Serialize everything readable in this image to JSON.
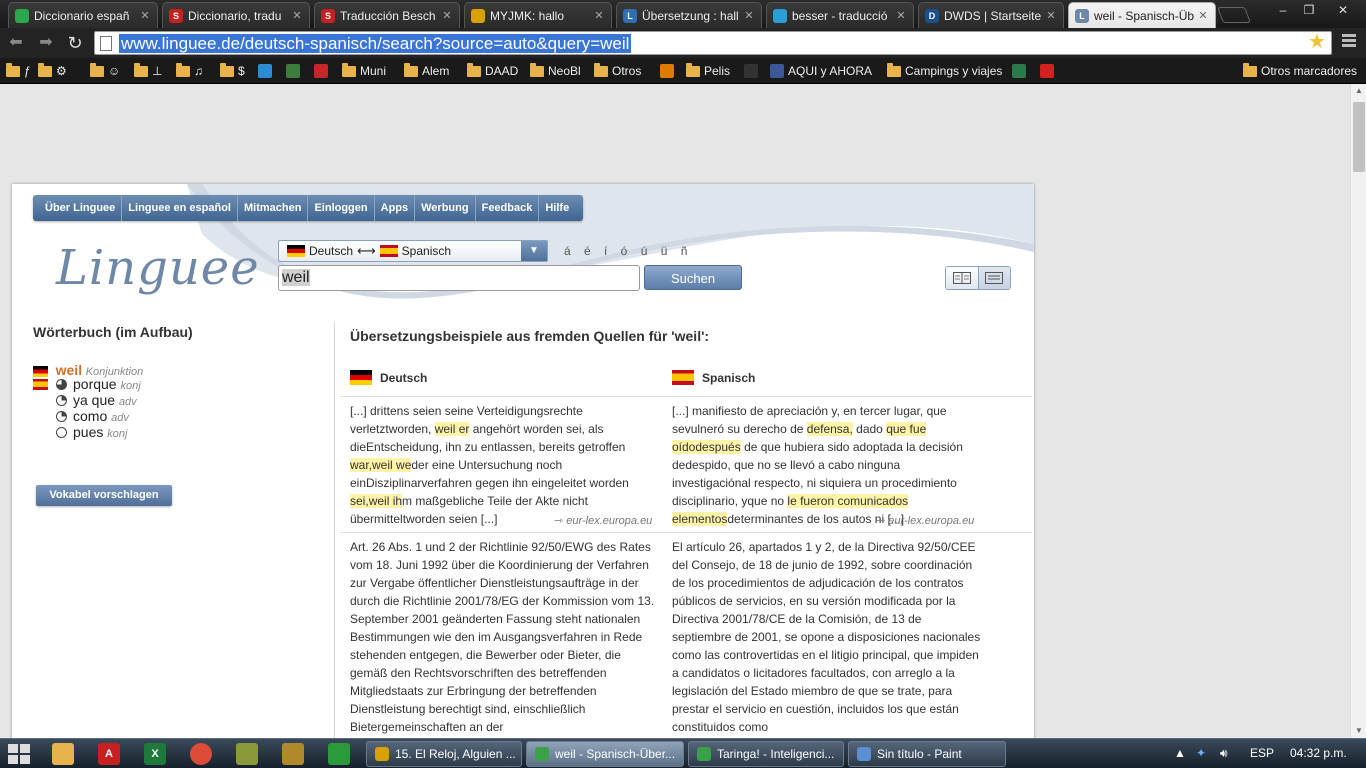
{
  "browser": {
    "tabs": [
      {
        "title": "Diccionario españ",
        "color": "#2aa84a",
        "glyph": ""
      },
      {
        "title": "Diccionario, tradu",
        "color": "#c62020",
        "glyph": "S"
      },
      {
        "title": "Traducción Besch",
        "color": "#c62020",
        "glyph": "S"
      },
      {
        "title": "MYJMK: hallo",
        "color": "#d9a100",
        "glyph": ""
      },
      {
        "title": "Übersetzung : hall",
        "color": "#2f6fb5",
        "glyph": "L"
      },
      {
        "title": "besser - traducció",
        "color": "#2a9fd6",
        "glyph": ""
      },
      {
        "title": "DWDS | Startseite",
        "color": "#1a4f8b",
        "glyph": "D"
      },
      {
        "title": "weil - Spanisch-Üb",
        "color": "#6f88a8",
        "glyph": "L"
      }
    ],
    "url": "www.linguee.de/deutsch-spanisch/search?source=auto&query=weil",
    "window_controls": [
      "–",
      "❐",
      "✕"
    ],
    "bookmarks": [
      {
        "label": "ƒ",
        "kind": "folder"
      },
      {
        "label": "⚙",
        "kind": "folder"
      },
      {
        "label": "☺",
        "kind": "folder"
      },
      {
        "label": "⊥",
        "kind": "folder"
      },
      {
        "label": "♫",
        "kind": "folder"
      },
      {
        "label": "$",
        "kind": "folder"
      },
      {
        "label": "",
        "kind": "site",
        "color": "#2a8bd6"
      },
      {
        "label": "",
        "kind": "site",
        "color": "#3b7d3b"
      },
      {
        "label": "",
        "kind": "site",
        "color": "#c62828"
      },
      {
        "label": "Muni",
        "kind": "folder"
      },
      {
        "label": "Alem",
        "kind": "folder"
      },
      {
        "label": "DAAD",
        "kind": "folder"
      },
      {
        "label": "NeoBl",
        "kind": "folder"
      },
      {
        "label": "Otros",
        "kind": "folder"
      },
      {
        "label": "",
        "kind": "site",
        "color": "#e07b00"
      },
      {
        "label": "Pelis",
        "kind": "folder"
      },
      {
        "label": "",
        "kind": "site",
        "color": "#333333"
      },
      {
        "label": "AQUI y AHORA",
        "kind": "site",
        "color": "#3b5998"
      },
      {
        "label": "Campings y viajes",
        "kind": "folder"
      },
      {
        "label": "",
        "kind": "site",
        "color": "#2a7a4a"
      },
      {
        "label": "",
        "kind": "site",
        "color": "#d32020"
      }
    ],
    "other_bookmarks": "Otros marcadores"
  },
  "page": {
    "nav": [
      "Über Linguee",
      "Linguee en español",
      "Mitmachen",
      "Einloggen",
      "Apps",
      "Werbung",
      "Feedback",
      "Hilfe"
    ],
    "logo": "Linguee",
    "lang_from": "Deutsch",
    "lang_to": "Spanisch",
    "special_chars": "á é í ó ú ü ñ",
    "search_value": "weil",
    "search_button": "Suchen",
    "dictionary": {
      "title": "Wörterbuch (im Aufbau)",
      "lemma": "weil",
      "lemma_pos": "Konjunktion",
      "translations": [
        {
          "word": "porque",
          "pos": "konj",
          "frequency": 0.75
        },
        {
          "word": "ya que",
          "pos": "adv",
          "frequency": 0.25
        },
        {
          "word": "como",
          "pos": "adv",
          "frequency": 0.25
        },
        {
          "word": "pues",
          "pos": "konj",
          "frequency": 0
        }
      ],
      "suggest_button": "Vokabel vorschlagen"
    },
    "examples": {
      "title": "Übersetzungsbeispiele aus fremden Quellen für 'weil':",
      "col_de": "Deutsch",
      "col_es": "Spanisch",
      "items": [
        {
          "de": [
            {
              "t": "[...] drittens seien seine Verteidigungsrechte verletzt"
            },
            {
              "t": "worden, "
            },
            {
              "t": "weil er",
              "hl": true
            },
            {
              "t": " angehört worden sei, als die"
            },
            {
              "t": "Entscheidung, ihn zu entlassen, bereits getroffen "
            },
            {
              "t": "war,",
              "hl": true
            },
            {
              "t": "weil we",
              "hl": true
            },
            {
              "t": "der eine Untersuchung noch ein"
            },
            {
              "t": "Disziplinarverfahren gegen ihn eingeleitet worden "
            },
            {
              "t": "sei,",
              "hl": true
            },
            {
              "t": "weil ih",
              "hl": true
            },
            {
              "t": "m maßgebliche Teile der Akte nicht übermittelt"
            },
            {
              "t": "worden seien [...]"
            }
          ],
          "es": [
            {
              "t": "[...] manifiesto de apreciación y, en tercer lugar, que se"
            },
            {
              "t": "vulneró su derecho de "
            },
            {
              "t": "defensa,",
              "hl": true
            },
            {
              "t": " dado "
            },
            {
              "t": "que fue oído",
              "hl": true
            },
            {
              "t": "después",
              "hl": true
            },
            {
              "t": " de que hubiera sido adoptada la decisión de"
            },
            {
              "t": "despido, que no se llevó a cabo ninguna investigación"
            },
            {
              "t": "al respecto, ni siquiera un procedimiento disciplinario, y"
            },
            {
              "t": "que no "
            },
            {
              "t": "le fueron comunicados elementos",
              "hl": true
            },
            {
              "t": "determinantes de los autos ni [...]"
            }
          ],
          "src_de": "eur-lex.europa.eu",
          "src_es": "eur-lex.europa.eu"
        },
        {
          "de_text": "Art. 26 Abs. 1 und 2 der Richtlinie 92/50/EWG des Rates vom 18. Juni 1992 über die Koordinierung der Verfahren zur Vergabe öffentlicher Dienstleistungsaufträge in der durch die Richtlinie 2001/78/EG der Kommission vom 13. September 2001 geänderten Fassung steht nationalen Bestimmungen wie den im Ausgangsverfahren in Rede stehenden entgegen, die Bewerber oder Bieter, die gemäß den Rechtsvorschriften des betreffenden Mitgliedstaats zur Erbringung der betreffenden Dienstleistung berechtigt sind, einschließlich Bietergemeinschaften an der",
          "es_text": "El artículo 26, apartados 1 y 2, de la Directiva 92/50/CEE del Consejo, de 18 de junio de 1992, sobre coordinación de los procedimientos de adjudicación de los contratos públicos de servicios, en su versión modificada por la Directiva 2001/78/CE de la Comisión, de 13 de septiembre de 2001, se opone a disposiciones nacionales como las controvertidas en el litigio principal, que impiden a candidatos o licitadores facultados, con arreglo a la legislación del Estado miembro de que se trate, para prestar el servicio en cuestión, incluidos los que están constituidos como"
        }
      ]
    }
  },
  "taskbar": {
    "tasks": [
      {
        "label": "15. El Reloj,  Alguien ...",
        "color": "#d9a100"
      },
      {
        "label": "weil - Spanisch-Über...",
        "color": "#3aa04a",
        "active": true
      },
      {
        "label": "Taringa! - Inteligenci...",
        "color": "#3aa04a"
      },
      {
        "label": "Sin título - Paint",
        "color": "#5a8fd0"
      }
    ],
    "tray_lang": "ESP",
    "clock": "04:32 p.m."
  }
}
